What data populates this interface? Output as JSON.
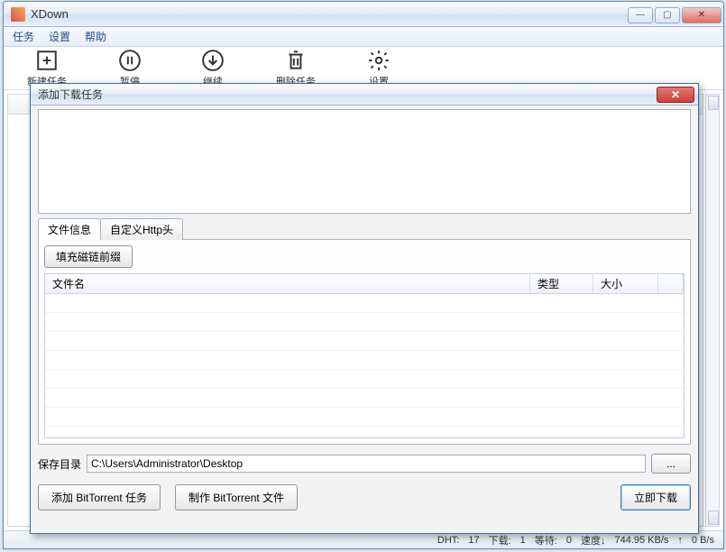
{
  "app": {
    "title": "XDown"
  },
  "menu": {
    "tasks": "任务",
    "settings": "设置",
    "help": "帮助"
  },
  "toolbar": {
    "new_task": "新建任务",
    "pause": "暂停",
    "resume": "继续",
    "delete": "删除任务",
    "settings": "设置"
  },
  "status": {
    "dht_label": "DHT:",
    "dht_value": "17",
    "down_label": "下载:",
    "down_value": "1",
    "wait_label": "等待:",
    "wait_value": "0",
    "speed_label": "速度↓",
    "speed_down": "744.95 KB/s",
    "speed_up_label": "↑",
    "speed_up": "0 B/s"
  },
  "dialog": {
    "title": "添加下载任务",
    "url_placeholder": "",
    "tabs": {
      "file_info": "文件信息",
      "http_headers": "自定义Http头"
    },
    "fill_magnet_btn": "填充磁链前缀",
    "columns": {
      "name": "文件名",
      "type": "类型",
      "size": "大小"
    },
    "save_dir_label": "保存目录",
    "save_dir_value": "C:\\Users\\Administrator\\Desktop",
    "browse_btn": "...",
    "add_bt_btn": "添加 BitTorrent 任务",
    "make_bt_btn": "制作 BitTorrent 文件",
    "download_btn": "立即下载"
  }
}
